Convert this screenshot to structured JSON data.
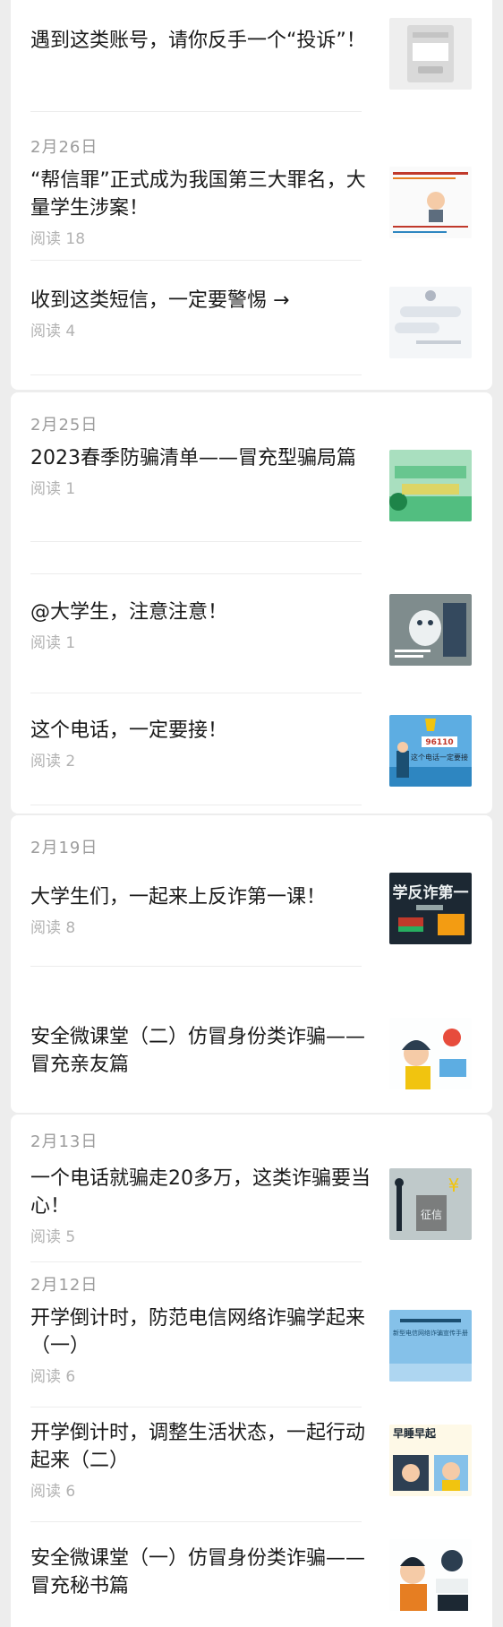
{
  "cards": [
    {
      "articles": [
        {
          "title": "遇到这类账号，请你反手一个“投诉”！",
          "reads": ""
        },
        {
          "date": "2月26日",
          "title": "“帮信罪”正式成为我国第三大罪名，大量学生涉案！",
          "reads": "阅读 18"
        },
        {
          "title": "收到这类短信，一定要警惕 →",
          "reads": "阅读 4"
        }
      ]
    },
    {
      "articles": [
        {
          "date": "2月25日",
          "title": "2023春季防骗清单——冒充型骗局篇",
          "reads": "阅读 1"
        },
        {
          "title": "@大学生，注意注意！",
          "reads": "阅读 1"
        },
        {
          "title": "这个电话，一定要接！",
          "reads": "阅读 2"
        }
      ]
    },
    {
      "articles": [
        {
          "date": "2月19日",
          "title": "大学生们，一起来上反诈第一课！",
          "reads": "阅读 8"
        },
        {
          "title": "安全微课堂（二）仿冒身份类诈骗——冒充亲友篇",
          "reads": ""
        }
      ]
    },
    {
      "articles": [
        {
          "date": "2月13日",
          "title": "一个电话就骗走20多万，这类诈骗要当心！",
          "reads": "阅读 5"
        },
        {
          "date": "2月12日",
          "title": "开学倒计时，防范电信网络诈骗学起来（一）",
          "reads": "阅读 6"
        },
        {
          "title": "开学倒计时，调整生活状态，一起行动起来（二）",
          "reads": "阅读 6"
        },
        {
          "title": "安全微课堂（一）仿冒身份类诈骗——冒充秘书篇",
          "reads": ""
        }
      ]
    }
  ],
  "thumbnails": {
    "t5_label": "96110",
    "t5_sub": "这个电话一定要接",
    "t6_label": "学反诈第一",
    "t8_label": "征信",
    "t9_label": "新型电信网络诈骗宣传手册",
    "t10_label": "早睡早起"
  }
}
